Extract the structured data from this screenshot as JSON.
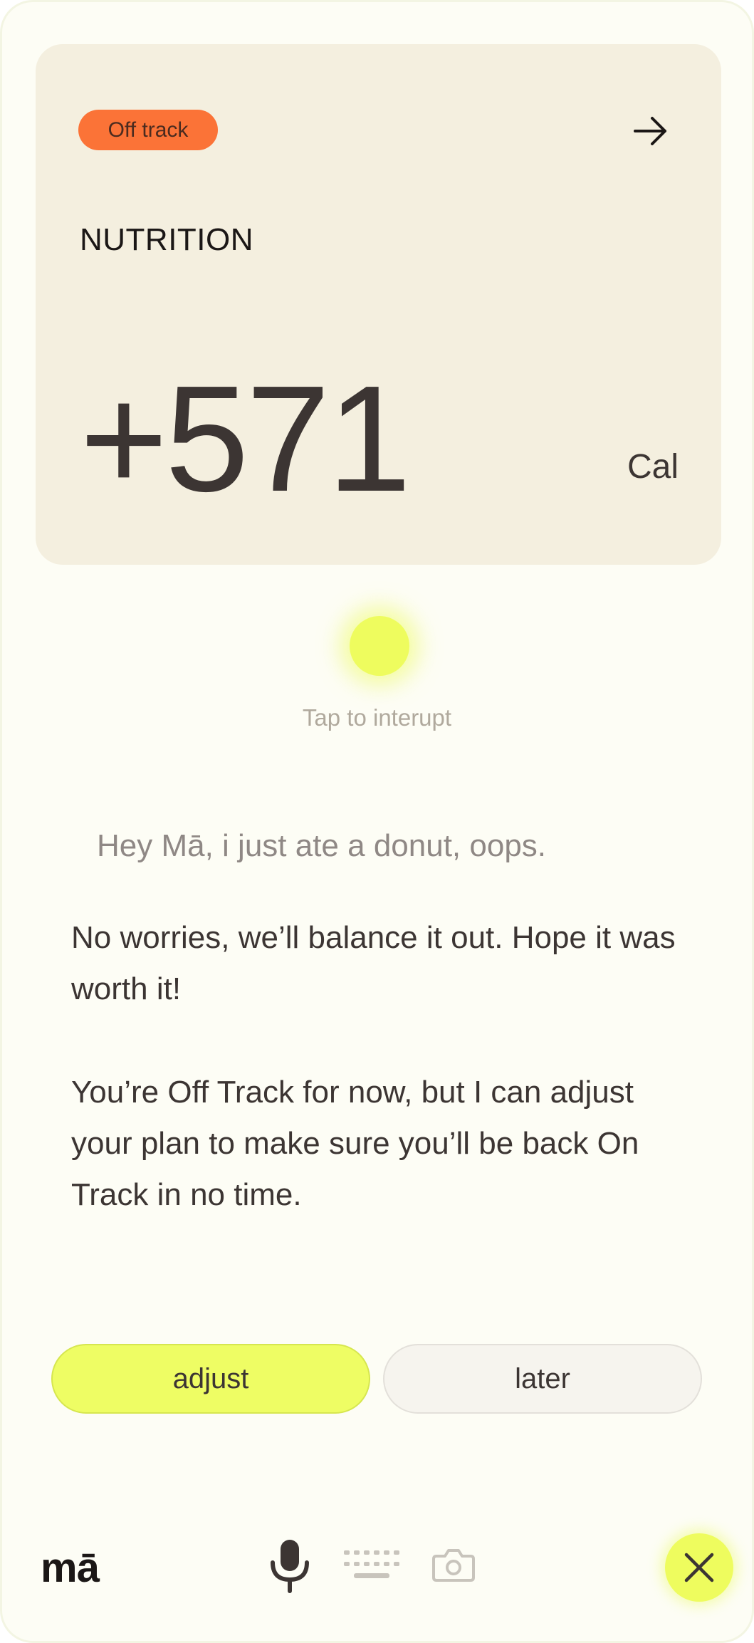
{
  "card": {
    "status_badge": "Off track",
    "title": "NUTRITION",
    "value": "+571",
    "unit": "Cal"
  },
  "voice": {
    "hint": "Tap to interupt"
  },
  "conversation": {
    "user_message": "Hey Mā, i just ate a donut, oops.",
    "assistant_messages": [
      "No worries, we’ll balance it out. Hope it was worth it!",
      "You’re Off Track for now, but I can adjust your plan to make sure you’ll be back On Track in no time."
    ]
  },
  "actions": {
    "adjust_label": "adjust",
    "later_label": "later"
  },
  "toolbar": {
    "logo": "mā",
    "icons": [
      "microphone-icon",
      "keyboard-icon",
      "camera-icon",
      "close-icon"
    ]
  },
  "colors": {
    "accent": "#eefc5e",
    "status_off_track": "#fb7337",
    "card_background": "#f4efdf"
  }
}
